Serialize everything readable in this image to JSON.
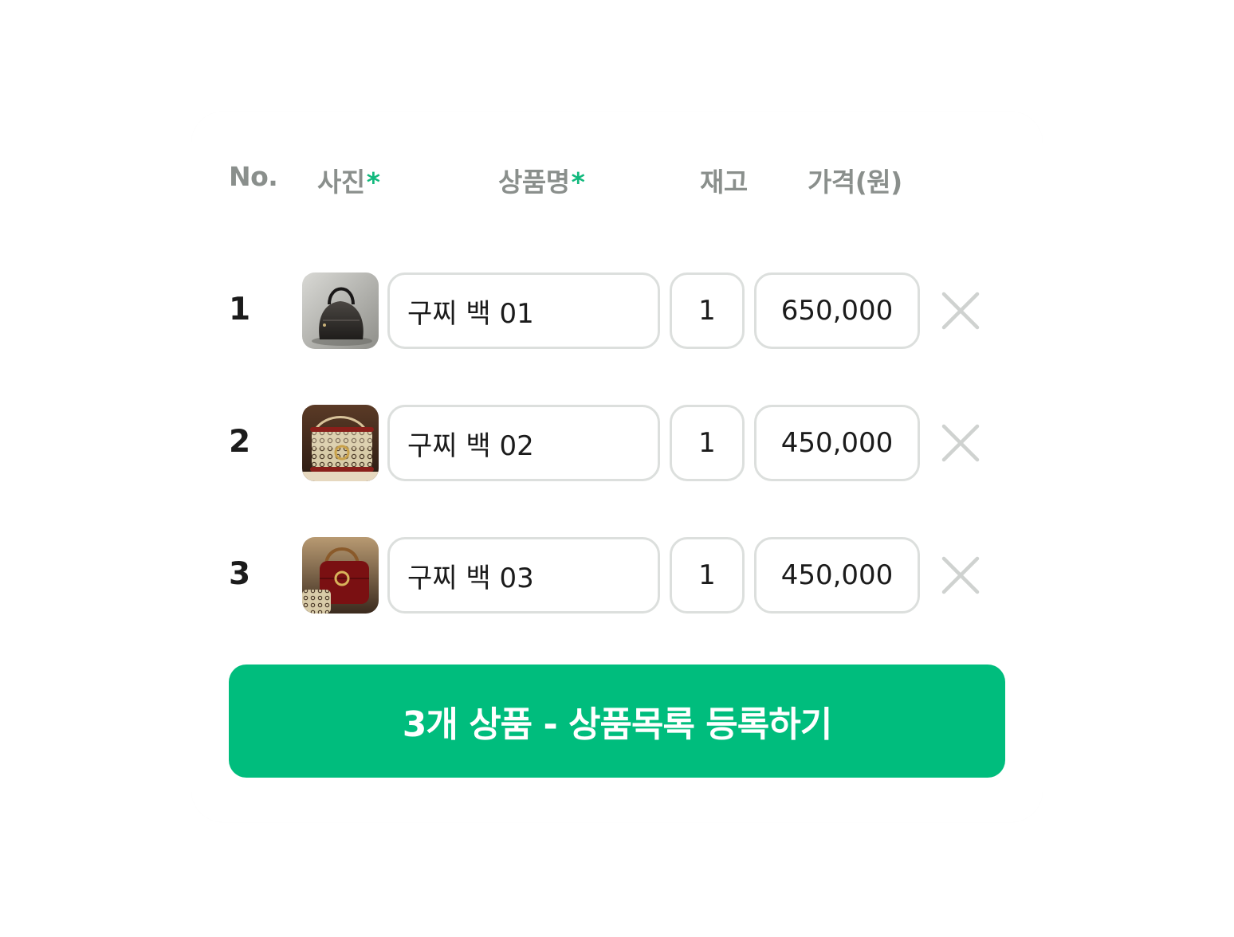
{
  "header": {
    "no": "No.",
    "photo": "사진",
    "name": "상품명",
    "stock": "재고",
    "price": "가격(원)",
    "required_mark": "*"
  },
  "rows": [
    {
      "num": "1",
      "thumb_icon": "black-handbag-photo",
      "name": "구찌 백 01",
      "stock": "1",
      "price": "650,000"
    },
    {
      "num": "2",
      "thumb_icon": "gg-monogram-bag-photo",
      "name": "구찌 백 02",
      "stock": "1",
      "price": "450,000"
    },
    {
      "num": "3",
      "thumb_icon": "red-velvet-bag-photo",
      "name": "구찌 백 03",
      "stock": "1",
      "price": "450,000"
    }
  ],
  "delete_icon": "close-icon",
  "submit_label": "3개 상품 - 상품목록 등록하기",
  "colors": {
    "accent": "#00bd7d",
    "required": "#12b97d",
    "header_text": "#8a8f8c",
    "field_border": "#dcdfdd",
    "close_icon": "#cfd2d0"
  }
}
